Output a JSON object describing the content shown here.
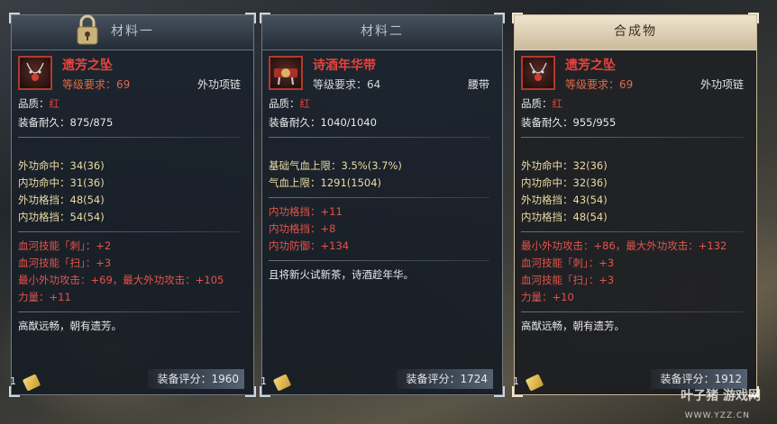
{
  "panels": [
    {
      "title": "材料一",
      "item_name": "遗芳之坠",
      "level_req": "等级要求：69",
      "item_type": "外功项链",
      "quality_label": "品质：",
      "quality_value": "红",
      "durability": "装备耐久：875/875",
      "base_stats": [
        "外功命中：34(36)",
        "内功命中：31(36)",
        "外功格挡：48(54)",
        "内功格挡：54(54)"
      ],
      "bonus_stats": [
        "血河技能「刺」：+2",
        "血河技能「扫」：+3",
        "最小外功攻击：+69，最大外功攻击：+105",
        "力量：+11"
      ],
      "description": "高猷远畅，朝有遗芳。",
      "count": "1",
      "score": "装备评分：1960"
    },
    {
      "title": "材料二",
      "item_name": "诗酒年华带",
      "level_req": "等级要求：64",
      "item_type": "腰带",
      "quality_label": "品质：",
      "quality_value": "红",
      "durability": "装备耐久：1040/1040",
      "base_stats": [
        "基础气血上限：3.5%(3.7%)",
        "气血上限：1291(1504)"
      ],
      "bonus_stats": [
        "内功格挡：+11",
        "内功格挡：+8",
        "内功防御：+134"
      ],
      "description": "且将新火试新茶，诗酒趁年华。",
      "count": "1",
      "score": "装备评分：1724"
    },
    {
      "title": "合成物",
      "item_name": "遗芳之坠",
      "level_req": "等级要求：69",
      "item_type": "外功项链",
      "quality_label": "品质：",
      "quality_value": "红",
      "durability": "装备耐久：955/955",
      "base_stats": [
        "外功命中：32(36)",
        "内功命中：32(36)",
        "外功格挡：43(54)",
        "内功格挡：48(54)"
      ],
      "bonus_stats": [
        "最小外功攻击：+86，最大外功攻击：+132",
        "血河技能「刺」：+3",
        "血河技能「扫」：+3",
        "力量：+10"
      ],
      "description": "高猷远畅，朝有遗芳。",
      "count": "1",
      "score": "装备评分：1912"
    }
  ],
  "watermark": {
    "text": "叶子猪 游戏网",
    "url": "WWW.YZZ.CN"
  },
  "colors": {
    "red_text": "#e4544a",
    "quality_red": "#e8433a",
    "stat_gold": "#e9dba2",
    "result_header": "#e6dac2"
  },
  "icons": {
    "lock": "lock-icon",
    "necklace": "necklace-icon",
    "belt": "belt-icon",
    "ticket": "ticket-icon"
  }
}
